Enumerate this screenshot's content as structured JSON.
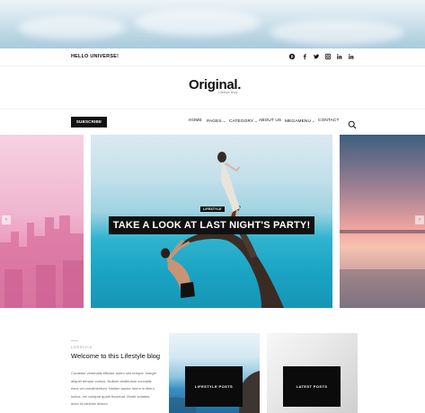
{
  "topbar": {
    "greeting": "HELLO UNIVERSE!",
    "social": [
      "pinterest-icon",
      "facebook-icon",
      "twitter-icon",
      "instagram-icon",
      "linkedin-icon",
      "linkedin-alt-icon"
    ]
  },
  "brand": {
    "logo": "Original.",
    "tagline": "Lifestyle Blog"
  },
  "nav": {
    "subscribe": "SUBSCRIBE",
    "items": [
      {
        "label": "HOME"
      },
      {
        "label": "PAGES"
      },
      {
        "label": "CATEGORY"
      },
      {
        "label": "ABOUT US"
      },
      {
        "label": "MEGAMENU"
      },
      {
        "label": "CONTACT"
      }
    ]
  },
  "slider": {
    "badge": "LIFESTYLE",
    "headline": "TAKE A LOOK AT LAST NIGHT'S PARTY!",
    "prev": "‹",
    "next": "›"
  },
  "intro": {
    "kicker": "LIFESTYLE",
    "title": "Welcome to this Lifestyle blog",
    "body": "Curabitur venenatis efficitur lorem sed tempor. Integer aliquet tempor cursus. Nullam vestibulum convallis risus vel condimentum. Nullam auctor lorem in libero luctus, vel volutpat quam tincidunt. Morbi sodales, dolor id ultricies dictum"
  },
  "cards": [
    {
      "label": "LIFESTYLE POSTS"
    },
    {
      "label": "LATEST POSTS"
    }
  ],
  "colors": {
    "accent": "#111111",
    "background": "#ffffff"
  }
}
